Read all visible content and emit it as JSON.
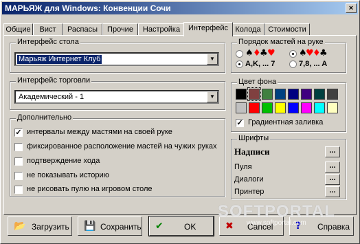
{
  "window": {
    "title": "МАРЬЯЖ для Windows: Конвенции Сочи",
    "close_glyph": "×"
  },
  "tabs": [
    {
      "label": "Общие"
    },
    {
      "label": "Вист"
    },
    {
      "label": "Распасы"
    },
    {
      "label": "Прочие"
    },
    {
      "label": "Настройка"
    },
    {
      "label": "Интерфейс"
    },
    {
      "label": "Колода"
    },
    {
      "label": "Стоимости"
    }
  ],
  "active_tab": "Интерфейс",
  "table_interface": {
    "label": "Интерфейс стола",
    "value": "Марьяж Интернет Клуб"
  },
  "trade_interface": {
    "label": "Интерфейс торговли",
    "value": "Академический - 1"
  },
  "additional": {
    "label": "Дополнительно",
    "options": [
      {
        "label": "интервалы между мастями на своей руке",
        "checked": true
      },
      {
        "label": "фиксированное расположение мастей на чужих руках",
        "checked": false
      },
      {
        "label": "подтверждение хода",
        "checked": false
      },
      {
        "label": "не показывать историю",
        "checked": false
      },
      {
        "label": "не рисовать пулю на игровом столе",
        "checked": false
      }
    ]
  },
  "suit_order": {
    "label": "Порядок мастей на руке",
    "order_label_1": "A,K, ... 7",
    "order_label_2": "7,8, ... A",
    "suits_glyphs": [
      "♠",
      "♦",
      "♣",
      "♥"
    ],
    "suit_colors": {
      "black": "#000000",
      "red": "#ff0000"
    }
  },
  "background": {
    "label": "Цвет фона",
    "colors": [
      "#000000",
      "#804040",
      "#408040",
      "#004080",
      "#000080",
      "#400080",
      "#004040",
      "#404040",
      "#c0c0c0",
      "#ff0000",
      "#00c000",
      "#ffff00",
      "#0000ff",
      "#ff00ff",
      "#00ffff",
      "#ffffc0"
    ],
    "selected_index": 1,
    "gradient_label": "Градиентная заливка",
    "gradient_checked": true
  },
  "fonts": {
    "label": "Шрифты",
    "items": [
      {
        "label": "Надписи"
      },
      {
        "label": "Пуля"
      },
      {
        "label": "Диалоги"
      },
      {
        "label": "Принтер"
      }
    ],
    "button_label": "..."
  },
  "buttons": {
    "load": "Загрузить",
    "save": "Сохранить",
    "ok": "OK",
    "cancel": "Cancel",
    "help": "Справка"
  },
  "watermark": {
    "brand": "SOFTPORTAL",
    "url": "www.softportal.com"
  }
}
